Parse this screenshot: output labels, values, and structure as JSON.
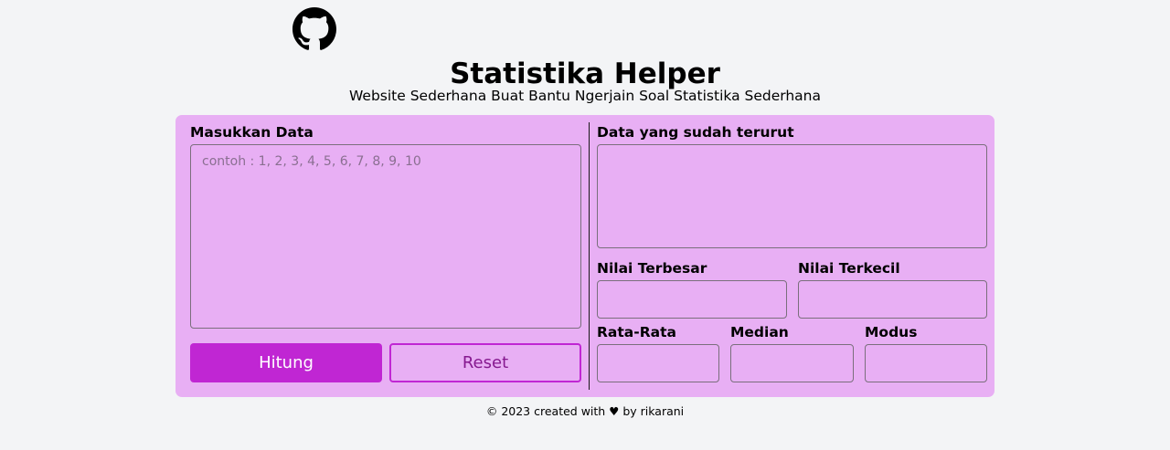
{
  "header": {
    "title": "Statistika Helper",
    "subtitle": "Website Sederhana Buat Bantu Ngerjain Soal Statistika Sederhana",
    "github_icon": "github-icon"
  },
  "input_section": {
    "label": "Masukkan Data",
    "placeholder": "contoh : 1, 2, 3, 4, 5, 6, 7, 8, 9, 10",
    "value": ""
  },
  "buttons": {
    "calculate_label": "Hitung",
    "reset_label": "Reset"
  },
  "results": {
    "sorted_label": "Data yang sudah terurut",
    "sorted_value": "",
    "max_label": "Nilai Terbesar",
    "max_value": "",
    "min_label": "Nilai Terkecil",
    "min_value": "",
    "mean_label": "Rata-Rata",
    "mean_value": "",
    "median_label": "Median",
    "median_value": "",
    "mode_label": "Modus",
    "mode_value": ""
  },
  "footer": {
    "text": "© 2023 created with ♥ by rikarani"
  },
  "colors": {
    "background": "#f3f4f6",
    "panel": "#e8aff4",
    "accent": "#c026d3",
    "accent_dark": "#86198f"
  }
}
